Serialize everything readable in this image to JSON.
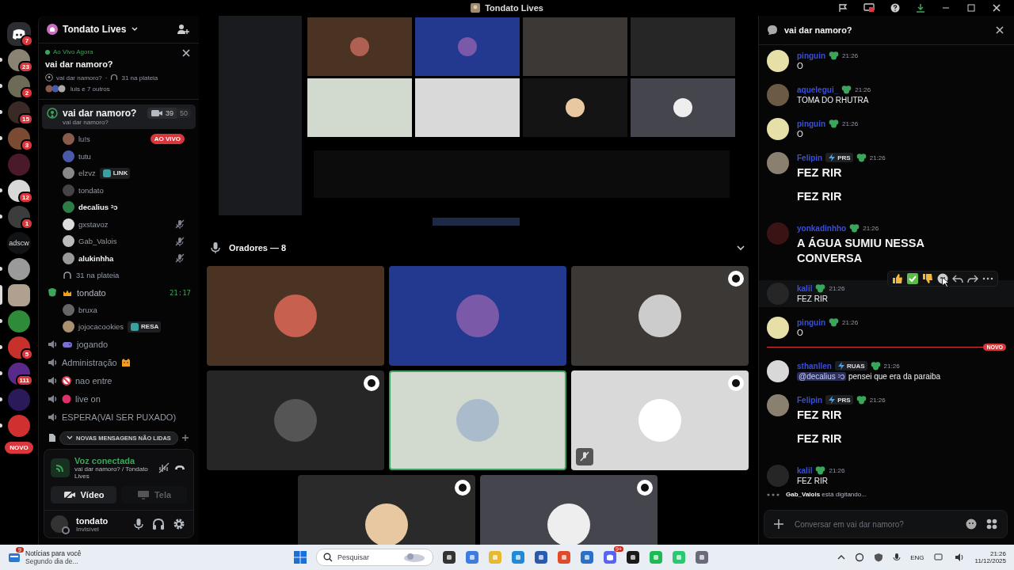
{
  "title_bar": {
    "title": "Tondato Lives"
  },
  "servers": [
    {
      "kind": "home",
      "badge": "7",
      "unread": false,
      "selected": false,
      "color": "#2b2d31"
    },
    {
      "kind": "avatar",
      "badge": "23",
      "unread": true,
      "selected": false,
      "color": "#8a8272"
    },
    {
      "kind": "avatar",
      "badge": "2",
      "unread": true,
      "selected": false,
      "color": "#6d6a55"
    },
    {
      "kind": "avatar",
      "badge": "15",
      "unread": true,
      "selected": false,
      "color": "#3a2a26"
    },
    {
      "kind": "avatar",
      "badge": "3",
      "unread": true,
      "selected": false,
      "color": "#7a4a32"
    },
    {
      "kind": "avatar",
      "unread": false,
      "selected": false,
      "color": "#4a1a2a"
    },
    {
      "kind": "avatar",
      "badge": "12",
      "unread": true,
      "selected": false,
      "color": "#d8d8d8"
    },
    {
      "kind": "avatar",
      "badge": "1",
      "unread": true,
      "selected": false,
      "color": "#3c3c3c"
    },
    {
      "kind": "text",
      "label": "adscw",
      "unread": false,
      "selected": false,
      "color": "#111214"
    },
    {
      "kind": "avatar",
      "unread": true,
      "selected": false,
      "color": "#9a9a9a"
    },
    {
      "kind": "avatar",
      "unread": false,
      "selected": true,
      "color": "#b0a090"
    },
    {
      "kind": "avatar",
      "unread": true,
      "selected": false,
      "color": "#2e8b3a"
    },
    {
      "kind": "avatar",
      "badge": "5",
      "unread": true,
      "selected": false,
      "color": "#c8302c"
    },
    {
      "kind": "avatar",
      "badge": "111",
      "unread": true,
      "selected": false,
      "color": "#5a2a8a"
    },
    {
      "kind": "avatar",
      "unread": true,
      "selected": false,
      "color": "#2a1a5a"
    },
    {
      "kind": "avatar",
      "unread": true,
      "selected": false,
      "color": "#d03030"
    }
  ],
  "servers_new_label": "NOVO",
  "server_header": {
    "name": "Tondato Lives"
  },
  "live_banner": {
    "status": "Ao Vivo Agora",
    "title": "vai dar namoro?",
    "channel": "vai dar namoro?",
    "separator": "·",
    "audience": "31 na plateia",
    "people": "luis e 7 outros"
  },
  "channels": [
    {
      "kind": "stage",
      "name": "vai dar namoro?",
      "subtitle": "vai dar namoro?",
      "selected": true,
      "video_count": "39",
      "limit": "50",
      "audience": "31 na plateia",
      "members": [
        {
          "name": "lu!s",
          "bold": false,
          "muted": false,
          "live": "AO VIVO"
        },
        {
          "name": "tutu",
          "bold": false,
          "muted": false
        },
        {
          "name": "elzvz",
          "bold": false,
          "muted": false,
          "tag": "LINK"
        },
        {
          "name": "tondato",
          "bold": false,
          "muted": false
        },
        {
          "name": "decalius ᵓↄ",
          "bold": true,
          "muted": false
        },
        {
          "name": "gxstavoz",
          "bold": false,
          "muted": true
        },
        {
          "name": "Gab_Valois",
          "bold": false,
          "muted": true
        },
        {
          "name": "alukinhha",
          "bold": true,
          "muted": true
        }
      ]
    },
    {
      "kind": "stage",
      "name": "tondato",
      "selected": false,
      "time": "21:17",
      "members": [
        {
          "name": "bruxa",
          "bold": false,
          "muted": false
        },
        {
          "name": "jojocacookies",
          "bold": false,
          "muted": false,
          "tag": "RESA"
        }
      ]
    },
    {
      "kind": "voice",
      "name": "jogando",
      "selected": false
    },
    {
      "kind": "voice",
      "name": "Administração",
      "selected": false
    },
    {
      "kind": "voice",
      "name": "nao entre",
      "selected": false
    },
    {
      "kind": "voice",
      "name": "live on",
      "selected": false
    },
    {
      "kind": "voice",
      "name": "ESPERA(VAI SER PUXADO)",
      "selected": false
    }
  ],
  "unread_pill": "NOVAS MENSAGENS NÃO LIDAS",
  "voice_panel": {
    "status": "Voz conectada",
    "location": "vai dar namoro? / Tondato Lives",
    "buttons": [
      {
        "label": "Vídeo",
        "disabled": false
      },
      {
        "label": "Tela",
        "disabled": true
      }
    ]
  },
  "user_panel": {
    "name": "tondato",
    "status": "Invisível"
  },
  "stage": {
    "heading": "Oradores — 8",
    "tiles": [
      {
        "color": "#4b3324",
        "badge": false,
        "muted": false,
        "speaking": false
      },
      {
        "color": "#23388f",
        "badge": false,
        "muted": false,
        "speaking": false
      },
      {
        "color": "#3b3836",
        "badge": true,
        "muted": false,
        "speaking": false
      },
      {
        "color": "#262626",
        "badge": true,
        "muted": false,
        "speaking": false
      },
      {
        "color": "#d2dad0",
        "badge": false,
        "muted": false,
        "speaking": true
      },
      {
        "color": "#d9d9d9",
        "badge": true,
        "muted": true,
        "speaking": false
      },
      {
        "color": "#2a2a2a",
        "badge": true,
        "muted": false,
        "speaking": false
      },
      {
        "color": "#45454d",
        "badge": true,
        "muted": false,
        "speaking": false
      }
    ]
  },
  "chat": {
    "title": "vai dar namoro?",
    "placeholder": "Conversar em vai dar namoro?",
    "messages": [
      {
        "kind": "message",
        "author": "pinguin",
        "time": "21:26",
        "lines": [
          "O"
        ],
        "big": false,
        "hovered": false,
        "color": "#e6e0a8"
      },
      {
        "kind": "message",
        "author": "aquelegui_",
        "time": "21:26",
        "lines": [
          "TOMA DO RHUTRA"
        ],
        "big": false,
        "hovered": false,
        "color": "#6b5a44"
      },
      {
        "kind": "message",
        "author": "pinguin",
        "time": "21:26",
        "lines": [
          "O"
        ],
        "big": false,
        "hovered": false,
        "color": "#e6e0a8"
      },
      {
        "kind": "message",
        "author": "Felipin",
        "tag": "PRS",
        "time": "21:26",
        "lines": [
          "FEZ RIR",
          "FEZ RIR"
        ],
        "big": true,
        "hovered": false,
        "color": "#8a8070"
      },
      {
        "kind": "message",
        "author": "yonkadinhho",
        "time": "21:26",
        "lines": [
          "A ÁGUA SUMIU NESSA CONVERSA"
        ],
        "big": true,
        "hovered": false,
        "color": "#3a1414"
      },
      {
        "kind": "message",
        "author": "kalil",
        "time": "21:26",
        "lines": [
          "FEZ RIR"
        ],
        "big": false,
        "hovered": true,
        "color": "#262626"
      },
      {
        "kind": "message",
        "author": "pinguin",
        "time": "21:26",
        "lines": [
          "O"
        ],
        "big": false,
        "hovered": false,
        "color": "#e6e0a8"
      },
      {
        "kind": "divider",
        "label": "NOVO"
      },
      {
        "kind": "message",
        "author": "sthanllen",
        "tag": "RUAS",
        "time": "21:26",
        "mention": "@decalius ᵓↄ",
        "lines": [
          "pensei que era da paraiba"
        ],
        "big": false,
        "hovered": false,
        "color": "#d8d8d8"
      },
      {
        "kind": "message",
        "author": "Felipin",
        "tag": "PRS",
        "time": "21:26",
        "lines": [
          "FEZ RIR",
          "FEZ RIR"
        ],
        "big": true,
        "hovered": false,
        "color": "#8a8070"
      },
      {
        "kind": "message",
        "author": "kalil",
        "time": "21:26",
        "lines": [
          "FEZ RIR"
        ],
        "big": false,
        "hovered": false,
        "color": "#262626"
      },
      {
        "kind": "typing",
        "text": "**Gab_Valois** está digitando..."
      }
    ]
  },
  "taskbar": {
    "news_badge": "9",
    "news_title": "Notícias para você",
    "news_subtitle": "Segundo dia de...",
    "search": "Pesquisar",
    "app_badge": "9+",
    "language": "ENG",
    "time": "21:26",
    "date": "11/12/2025"
  }
}
